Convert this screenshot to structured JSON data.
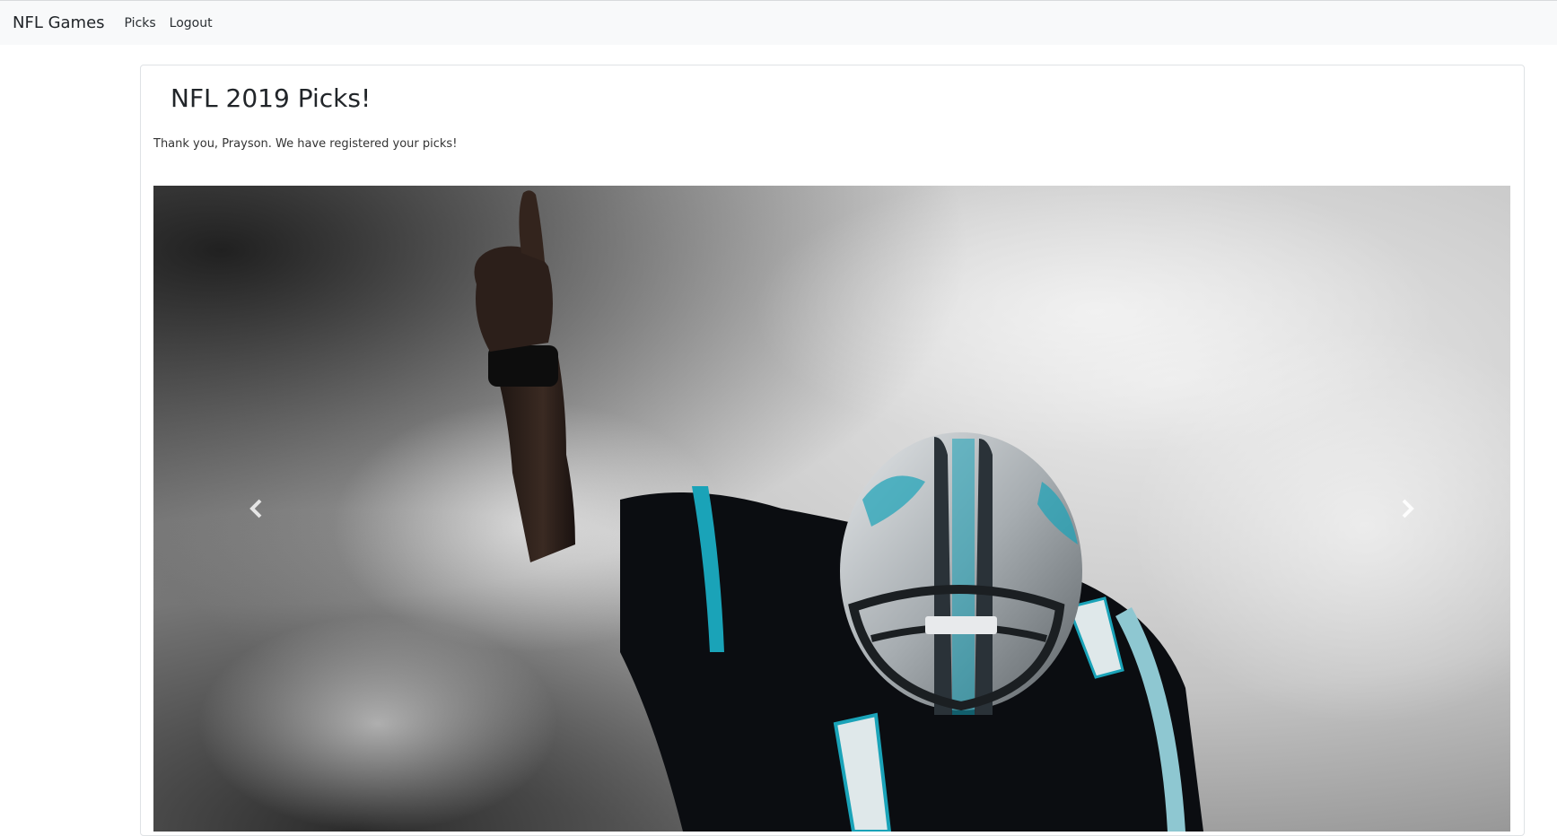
{
  "navbar": {
    "brand": "NFL Games",
    "links": [
      "Picks",
      "Logout"
    ]
  },
  "page": {
    "title": "NFL 2019 Picks!",
    "message": "Thank you, Prayson. We have registered your picks!"
  },
  "carousel": {
    "image_subject": "football player in smoke pointing up",
    "prev_icon": "chevron-left-icon",
    "next_icon": "chevron-right-icon",
    "colors": {
      "jersey": "#0a0c10",
      "accent": "#1aa3b8",
      "smoke": "#c9c9c9"
    }
  }
}
